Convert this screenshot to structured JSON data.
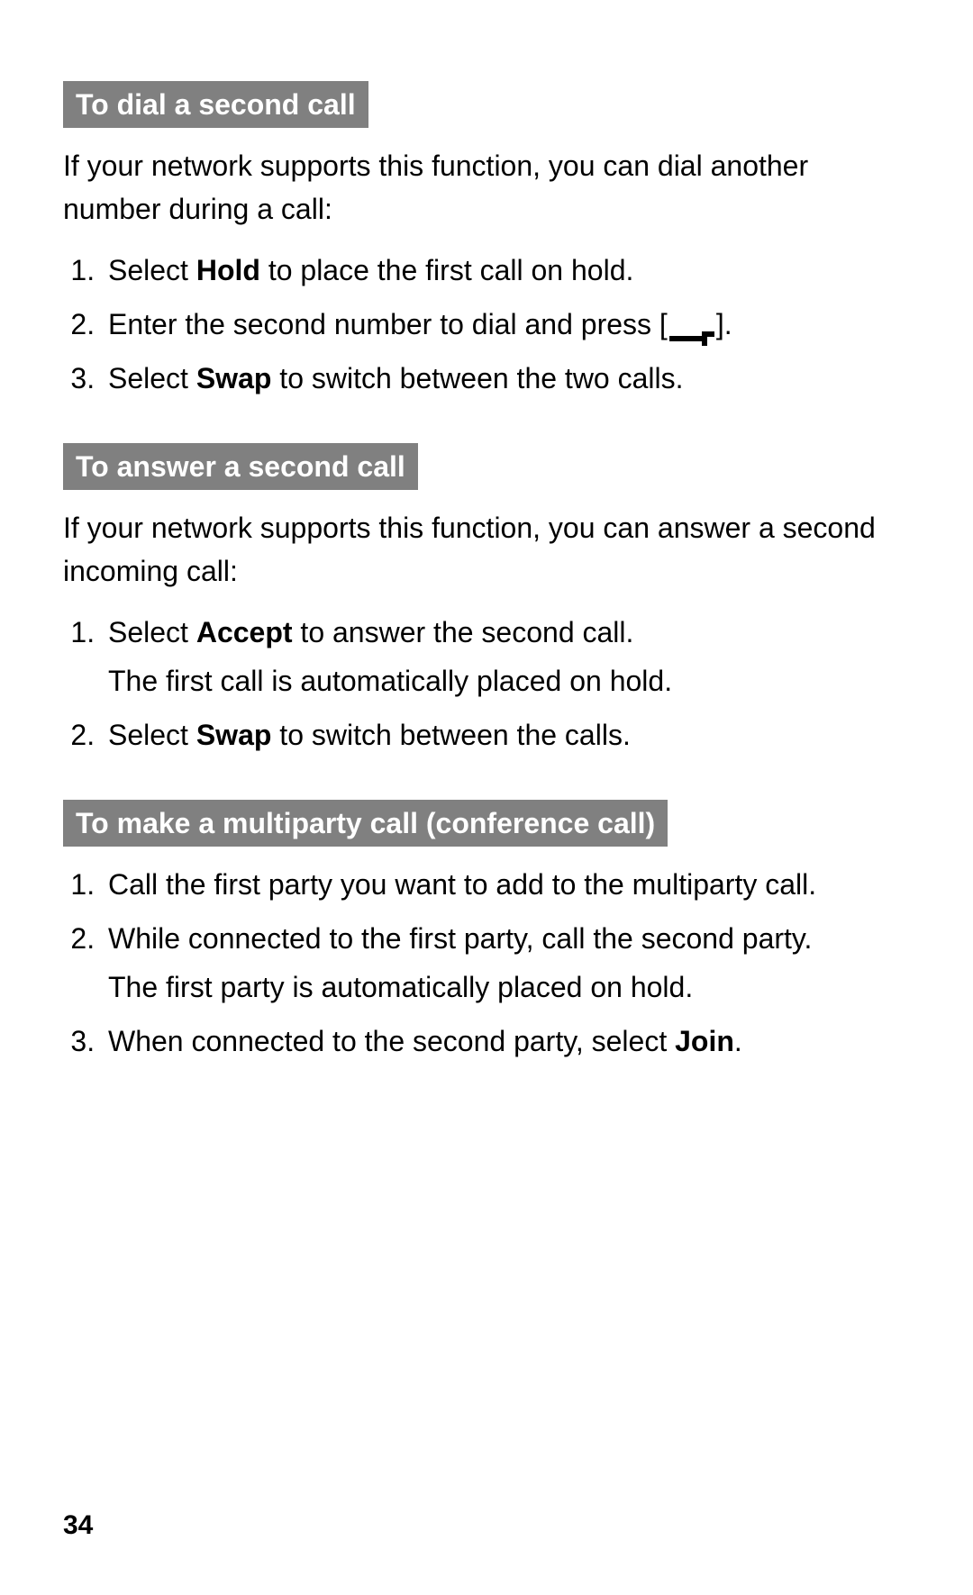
{
  "page_number": "34",
  "sections": [
    {
      "heading": "To dial a second call",
      "intro": "If your network supports this function, you can dial another number during a call:",
      "steps": [
        {
          "pre": "Select ",
          "bold": "Hold",
          "post": " to place the first call on hold."
        },
        {
          "pre": "Enter the second number to dial and press [",
          "icon": true,
          "post": "]."
        },
        {
          "pre": "Select ",
          "bold": "Swap",
          "post": " to switch between the two calls."
        }
      ]
    },
    {
      "heading": "To answer a second call",
      "intro": "If your network supports this function, you can answer a second incoming call:",
      "steps": [
        {
          "pre": "Select ",
          "bold": "Accept",
          "post": " to answer the second call.",
          "sub": "The first call is automatically placed on hold."
        },
        {
          "pre": "Select ",
          "bold": "Swap",
          "post": " to switch between the calls."
        }
      ]
    },
    {
      "heading": "To make a multiparty call (conference call)",
      "intro": "",
      "steps": [
        {
          "pre": "Call the first party you want to add to the multiparty call."
        },
        {
          "pre": "While connected to the first party, call the second party.",
          "sub": "The first party is automatically placed on hold."
        },
        {
          "pre": "When connected to the second party, select ",
          "bold": "Join",
          "post": "."
        }
      ]
    }
  ]
}
